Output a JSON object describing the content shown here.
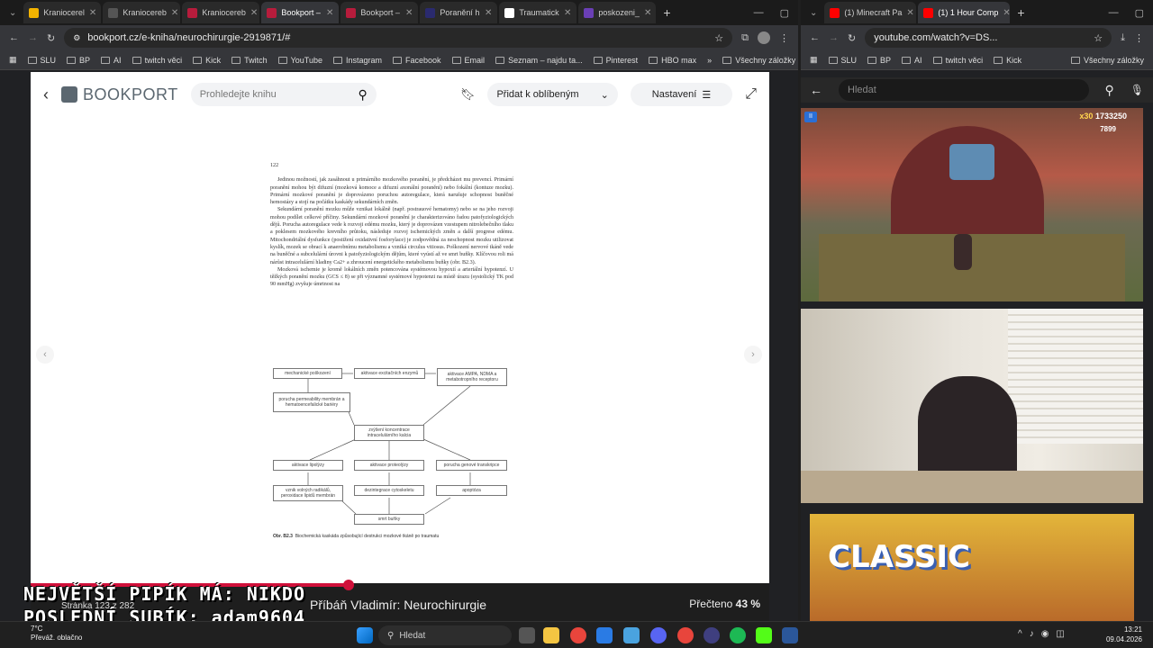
{
  "left_window": {
    "tabs": [
      {
        "label": "Kraniocerel",
        "color": "#f4b400"
      },
      {
        "label": "Kraniocereb",
        "color": "#555555"
      },
      {
        "label": "Kraniocereb",
        "color": "#b71c3c"
      },
      {
        "label": "Bookport –",
        "color": "#b71c3c",
        "active": true
      },
      {
        "label": "Bookport –",
        "color": "#b71c3c"
      },
      {
        "label": "Poranění h",
        "color": "#2a2a6e"
      },
      {
        "label": "Traumatick",
        "color": "#ffffff"
      },
      {
        "label": "poskozeni_",
        "color": "#6a3fb5"
      }
    ],
    "url": "bookport.cz/e-kniha/neurochirurgie-2919871/#",
    "bookmarks": [
      "SLU",
      "BP",
      "AI",
      "twitch věci",
      "Kick",
      "Twitch",
      "YouTube",
      "Instagram",
      "Facebook",
      "Email",
      "Seznam – najdu ta...",
      "Pinterest",
      "HBO max"
    ],
    "bookmarks_all": "Všechny záložky",
    "bookport": {
      "logo": "BOOKPORT",
      "search_placeholder": "Prohledejte knihu",
      "favorites_label": "Přidat k oblíbeným",
      "settings_label": "Nastavení",
      "page_number": "122",
      "paragraphs": [
        "Jedinou možností, jak zasáhnout u primárního mozkového poranění, je předcházet mu prevencí. Primární poranění mohou být difuzní (mozková komoce a difuzní axonální poranění) nebo fokální (kontuze mozku). Primární mozkové poranění je doprovázeno poruchou autoregulace, která narušuje schopnost buněčné hemostázy a stojí na počátku kaskády sekundárních změn.",
        "Sekundární poranění mozku může vznikat lokálně (např. postrauové hematomy) nebo se na jeho rozvoji mohou podílet celkové příčiny. Sekundární mozkové poranění je charakterizováno řadou patofyziologických dějů. Porucha autoregulace vede k rozvoji edému mozku, který je doprovázen vzestupem nitrolebečního tlaku a poklesem mozkového krevního průtoku, následuje rozvoj ischemických změn a další progrese edému. Mitochondriální dysfunkce (postižení oxidativní fosforylace) je zodpovědná za neschopnost mozku utilizovat kyslík, mozek se obrací k anaerobnímu metabolismu a vzniká circulus vitiosus. Poškození nervové tkáně vede na buněčné a subcelulární úrovni k patofyziologickým dějům, které vyústí až ve smrt buňky. Klíčovou roli má nárůst intracelulární hladiny Ca2+ a zhroucení energetického metabolismu buňky (obr. B2.3).",
        "Mozková ischemie je kromě lokálních změn potencována systémovou hypoxií a arteriální hypotenzí. U těžkých poranění mozku (GCS ≤ 8) se při významné systémové hypotenzi na místě úrazu (systolický TK pod 90 mmHg) zvyšuje úmrtnost na"
      ],
      "flow": {
        "n1": "mechanické poškození",
        "n2": "aktivace excitačních enzymů",
        "n3": "aktivace AMPA, NDMA a metabotropního receptoru",
        "n4": "porucha permeability membrán a hematoencefalické bariéry",
        "n5": "zvýšení koncentrace intracelulárního kalcia",
        "n6": "aktivace lipolýzy",
        "n7": "aktivace proteolýzy",
        "n8": "porucha genové transkripce",
        "n9": "vznik volných radikálů, peroxidace lipidů membrán",
        "n10": "dezintegrace cytoskeletu",
        "n11": "apoptóza",
        "n12": "smrt buňky"
      },
      "caption_label": "Obr. B2.3",
      "caption": "Biochemická kaskáda způsobující destrukci mozkové tkáně po traumatu",
      "footer_book": "Příbáň Vladimír: Neurochirurgie",
      "footer_read_label": "Přečteno",
      "footer_read_value": "43 %",
      "read_fraction": 0.43,
      "page_info": "Stránka 123 z 282"
    }
  },
  "right_window": {
    "tabs": [
      {
        "label": "(1) Minecraft Pa",
        "color": "#ff0000"
      },
      {
        "label": "(1) 1 Hour Comp",
        "color": "#ff0000",
        "active": true
      }
    ],
    "url": "youtube.com/watch?v=DS...",
    "bookmarks": [
      "SLU",
      "BP",
      "AI",
      "twitch věci",
      "Kick"
    ],
    "bookmarks_all": "Všechny záložky",
    "search_placeholder": "Hledat",
    "game": {
      "multiplier": "x30",
      "score": "1733250",
      "coins": "7899"
    },
    "classic_text": "CLASSIC"
  },
  "overlay": {
    "line1": "NEJVĚTŠÍ PIPÍK MÁ: NIKDO",
    "line2": "POSLEDNÍ SUBÍK: adam9604"
  },
  "taskbar": {
    "weather_temp": "7°C",
    "weather_desc": "Převáž. oblačno",
    "search": "Hledat",
    "time": "13:21",
    "date": "09.04.2026"
  }
}
